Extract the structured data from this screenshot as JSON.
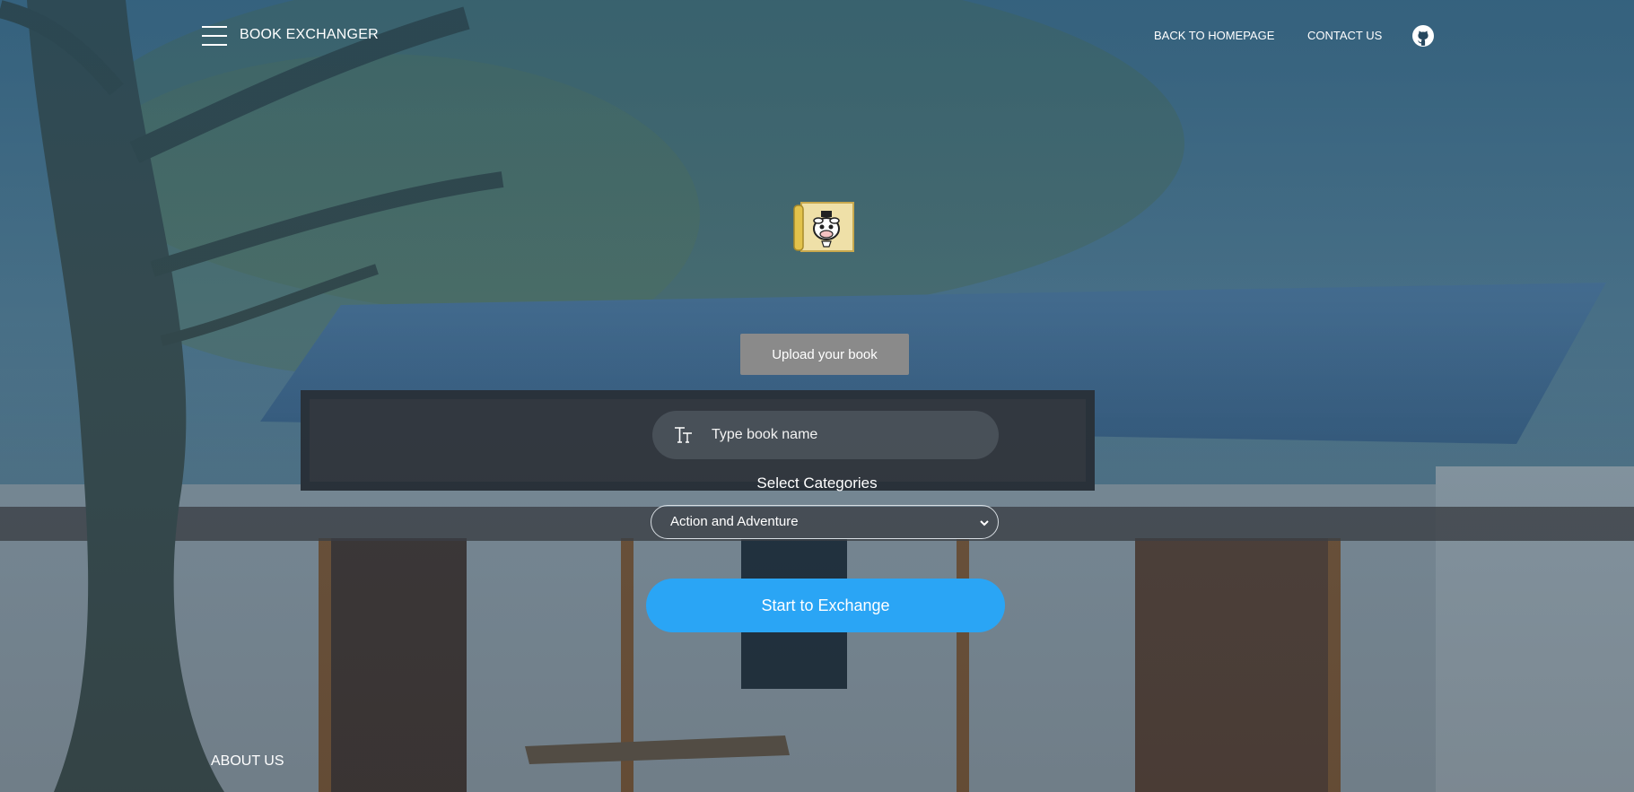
{
  "header": {
    "brand": "BOOK EXCHANGER",
    "nav": {
      "back_label": "BACK TO HOMEPAGE",
      "contact_label": "CONTACT US"
    },
    "icons": {
      "menu": "hamburger-menu-icon",
      "github": "github-icon"
    }
  },
  "main": {
    "logo_icon": "cow-scroll-logo",
    "upload_label": "Upload your book",
    "book_input": {
      "placeholder": "Type book name",
      "value": "",
      "icon": "text-format-icon"
    },
    "categories_label": "Select Categories",
    "category_select": {
      "selected": "Action and Adventure"
    },
    "start_label": "Start to Exchange"
  },
  "footer": {
    "about_label": "ABOUT US"
  },
  "colors": {
    "primary_button": "#2aa5f5",
    "upload_button": "#8a8a8a",
    "overlay_tint": "#1a3c5a"
  }
}
